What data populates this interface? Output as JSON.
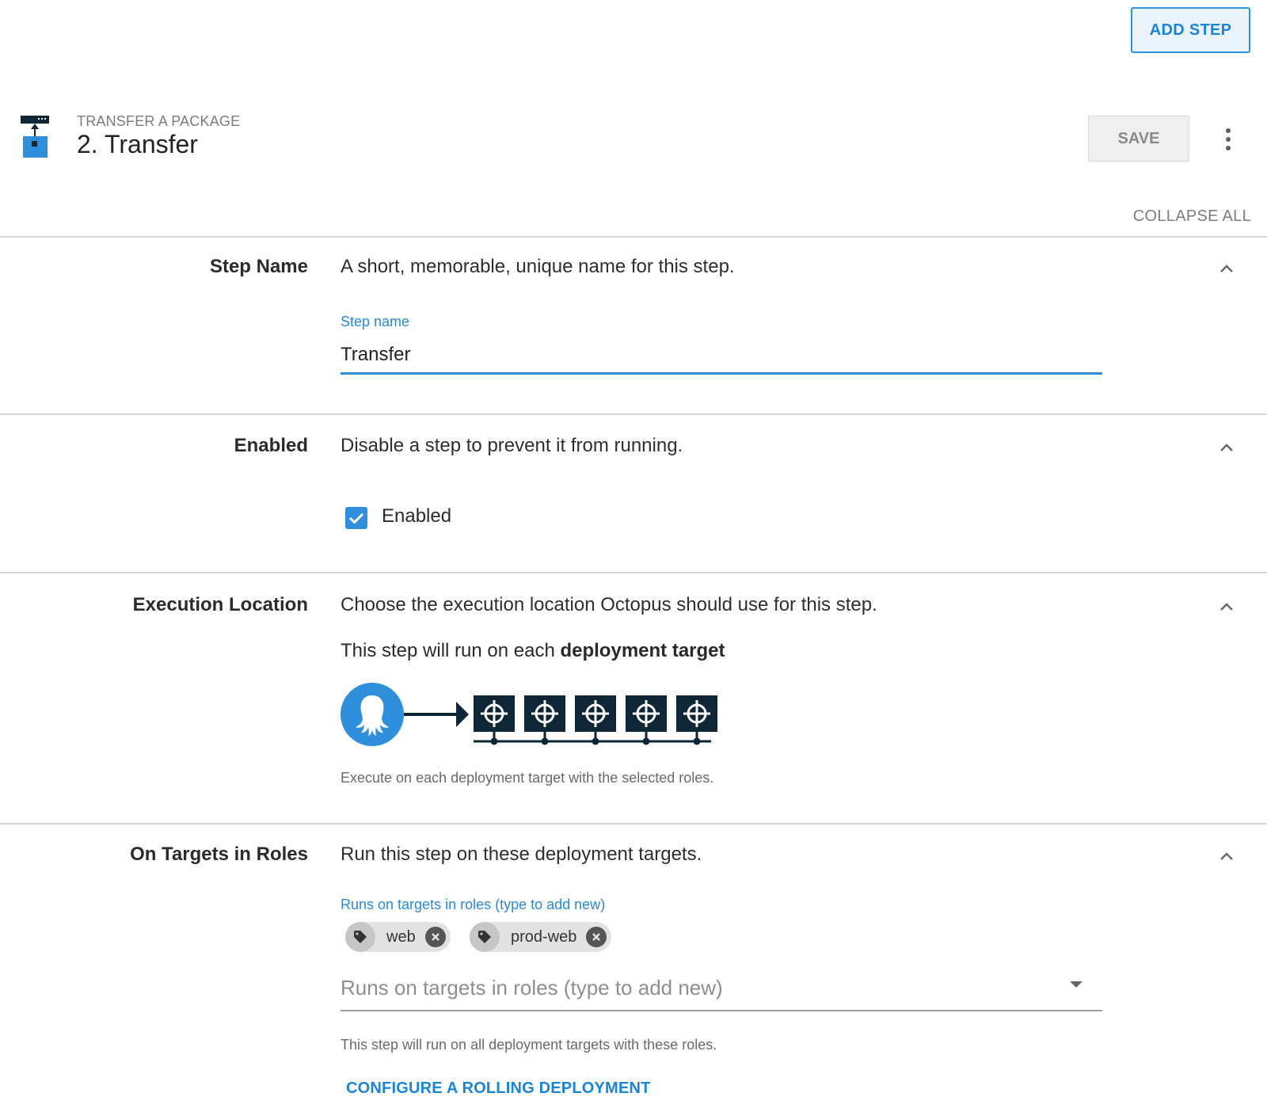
{
  "header": {
    "add_step_label": "ADD STEP",
    "step_type": "TRANSFER A PACKAGE",
    "step_number": "2.",
    "step_title": "Transfer",
    "save_label": "SAVE",
    "collapse_all_label": "COLLAPSE ALL"
  },
  "sections": {
    "step_name": {
      "label": "Step Name",
      "description": "A short, memorable, unique name for this step.",
      "field_label": "Step name",
      "field_value": "Transfer"
    },
    "enabled": {
      "label": "Enabled",
      "description": "Disable a step to prevent it from running.",
      "checkbox_label": "Enabled",
      "checked": true
    },
    "execution_location": {
      "label": "Execution Location",
      "description": "Choose the execution location Octopus should use for this step.",
      "run_text_prefix": "This step will run on each",
      "run_text_bold": "deployment target",
      "help_text": "Execute on each deployment target with the selected roles."
    },
    "target_roles": {
      "label": "On Targets in Roles",
      "description": "Run this step on these deployment targets.",
      "field_label": "Runs on targets in roles (type to add new)",
      "roles": [
        "web",
        "prod-web"
      ],
      "input_placeholder": "Runs on targets in roles (type to add new)",
      "help_text": "This step will run on all deployment targets with these roles.",
      "rolling_link": "CONFIGURE A ROLLING DEPLOYMENT"
    }
  },
  "colors": {
    "accent": "#2f8fdc",
    "link": "#1a84d8",
    "dark_navy": "#0e2636",
    "octopus_blue": "#2f8fdc"
  },
  "icons": [
    "transfer-package-icon",
    "more-vert-icon",
    "chevron-up-icon",
    "check-icon",
    "octopus-logo-icon",
    "deployment-target-icon",
    "tag-icon",
    "close-circle-icon",
    "dropdown-caret-icon"
  ]
}
